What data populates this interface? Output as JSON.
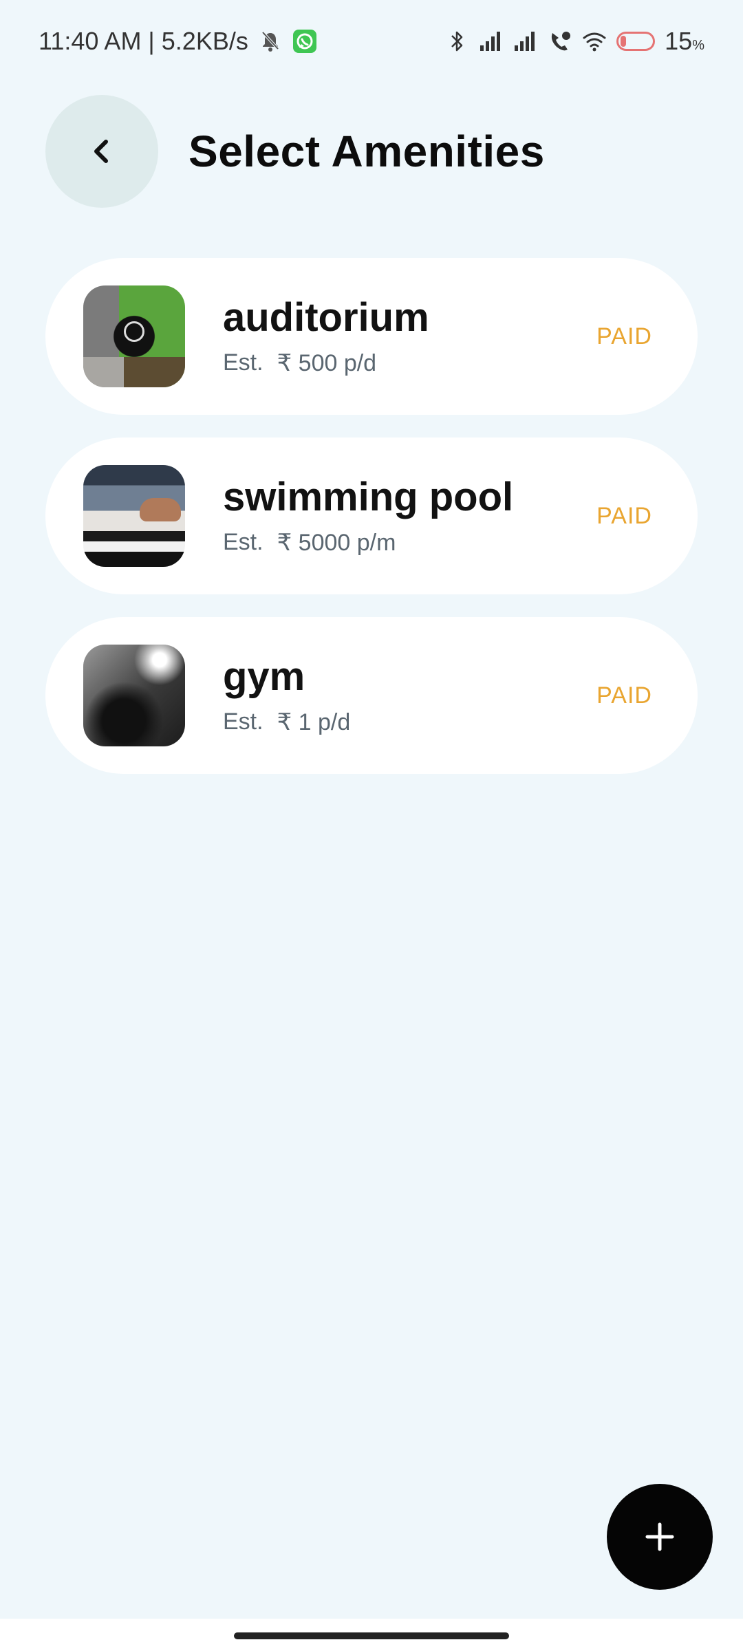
{
  "status_bar": {
    "time_info": "11:40 AM | 5.2KB/s",
    "battery_percent": "15",
    "battery_unit": "%",
    "battery_level": 0.15,
    "icons": [
      "mute-bell-icon",
      "whatsapp-icon",
      "bluetooth-icon",
      "signal-icon",
      "signal-icon",
      "call-icon",
      "wifi-icon",
      "battery-icon"
    ]
  },
  "header": {
    "title": "Select Amenities",
    "back_icon": "chevron-left-icon"
  },
  "amenities": [
    {
      "name": "auditorium",
      "est_label": "Est.",
      "price": "₹ 500 p/d",
      "badge": "PAID"
    },
    {
      "name": "swimming pool",
      "est_label": "Est.",
      "price": "₹ 5000 p/m",
      "badge": "PAID"
    },
    {
      "name": "gym",
      "est_label": "Est.",
      "price": "₹ 1 p/d",
      "badge": "PAID"
    }
  ],
  "fab": {
    "icon": "plus-icon"
  },
  "colors": {
    "background": "#eff7fb",
    "card": "#ffffff",
    "paid_badge": "#e9a530",
    "fab": "#050505",
    "back_button": "#deebec"
  }
}
